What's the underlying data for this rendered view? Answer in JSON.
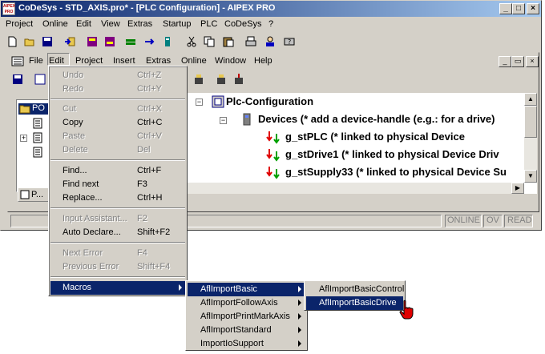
{
  "window": {
    "title": "CoDeSys - STD_AXIS.pro* - [PLC Configuration] - AIPEX PRO",
    "icon_text_1": "AIPEX",
    "icon_text_2": "PRO",
    "controls": [
      "minimize",
      "maximize",
      "close"
    ]
  },
  "main_menu": [
    "Project",
    "Online",
    "Edit",
    "View",
    "Extras",
    "Startup",
    "PLC",
    "CoDeSys",
    "?"
  ],
  "toolbar_icons": [
    "new-icon",
    "open-icon",
    "save-icon",
    "login-icon",
    "build-icon",
    "rebuild-icon",
    "run-icon",
    "stop-icon",
    "device-icon",
    "cut-icon",
    "copy-icon",
    "paste-icon",
    "print-icon",
    "user-icon",
    "help-icon"
  ],
  "child_menu": [
    "File",
    "Edit",
    "Project",
    "Insert",
    "Extras",
    "Online",
    "Window",
    "Help"
  ],
  "tree_left": {
    "items": [
      "PO",
      "",
      ""
    ],
    "tab_label": "P..."
  },
  "plc_config": {
    "root": "Plc-Configuration",
    "devices": "Devices (* add a device-handle (e.g.: for a drive)",
    "children": [
      "g_stPLC (* linked to physical Device",
      "g_stDrive1 (* linked to physical Device Driv",
      "g_stSupply33 (* linked to physical Device Su"
    ]
  },
  "status": {
    "online": "ONLINE",
    "ov": "OV",
    "read": "READ"
  },
  "edit_menu": {
    "items": [
      {
        "label": "Undo",
        "shortcut": "Ctrl+Z",
        "enabled": false
      },
      {
        "label": "Redo",
        "shortcut": "Ctrl+Y",
        "enabled": false
      },
      {
        "label": "Cut",
        "shortcut": "Ctrl+X",
        "enabled": false
      },
      {
        "label": "Copy",
        "shortcut": "Ctrl+C",
        "enabled": true
      },
      {
        "label": "Paste",
        "shortcut": "Ctrl+V",
        "enabled": false
      },
      {
        "label": "Delete",
        "shortcut": "Del",
        "enabled": false
      },
      {
        "label": "Find...",
        "shortcut": "Ctrl+F",
        "enabled": true
      },
      {
        "label": "Find next",
        "shortcut": "F3",
        "enabled": true
      },
      {
        "label": "Replace...",
        "shortcut": "Ctrl+H",
        "enabled": true
      },
      {
        "label": "Input Assistant...",
        "shortcut": "F2",
        "enabled": false
      },
      {
        "label": "Auto Declare...",
        "shortcut": "Shift+F2",
        "enabled": true
      },
      {
        "label": "Next Error",
        "shortcut": "F4",
        "enabled": false
      },
      {
        "label": "Previous Error",
        "shortcut": "Shift+F4",
        "enabled": false
      },
      {
        "label": "Macros",
        "shortcut": "",
        "enabled": true
      }
    ]
  },
  "macros_menu": {
    "items": [
      "AflImportBasic",
      "AflImportFollowAxis",
      "AflImportPrintMarkAxis",
      "AflImportStandard",
      "ImportIoSupport"
    ]
  },
  "afl_menu": {
    "items": [
      "AflImportBasicControl",
      "AflImportBasicDrive"
    ]
  },
  "colors": {
    "title_start": "#0a246a",
    "title_end": "#a6caf0",
    "highlight": "#0a246a",
    "face": "#d4d0c8"
  }
}
